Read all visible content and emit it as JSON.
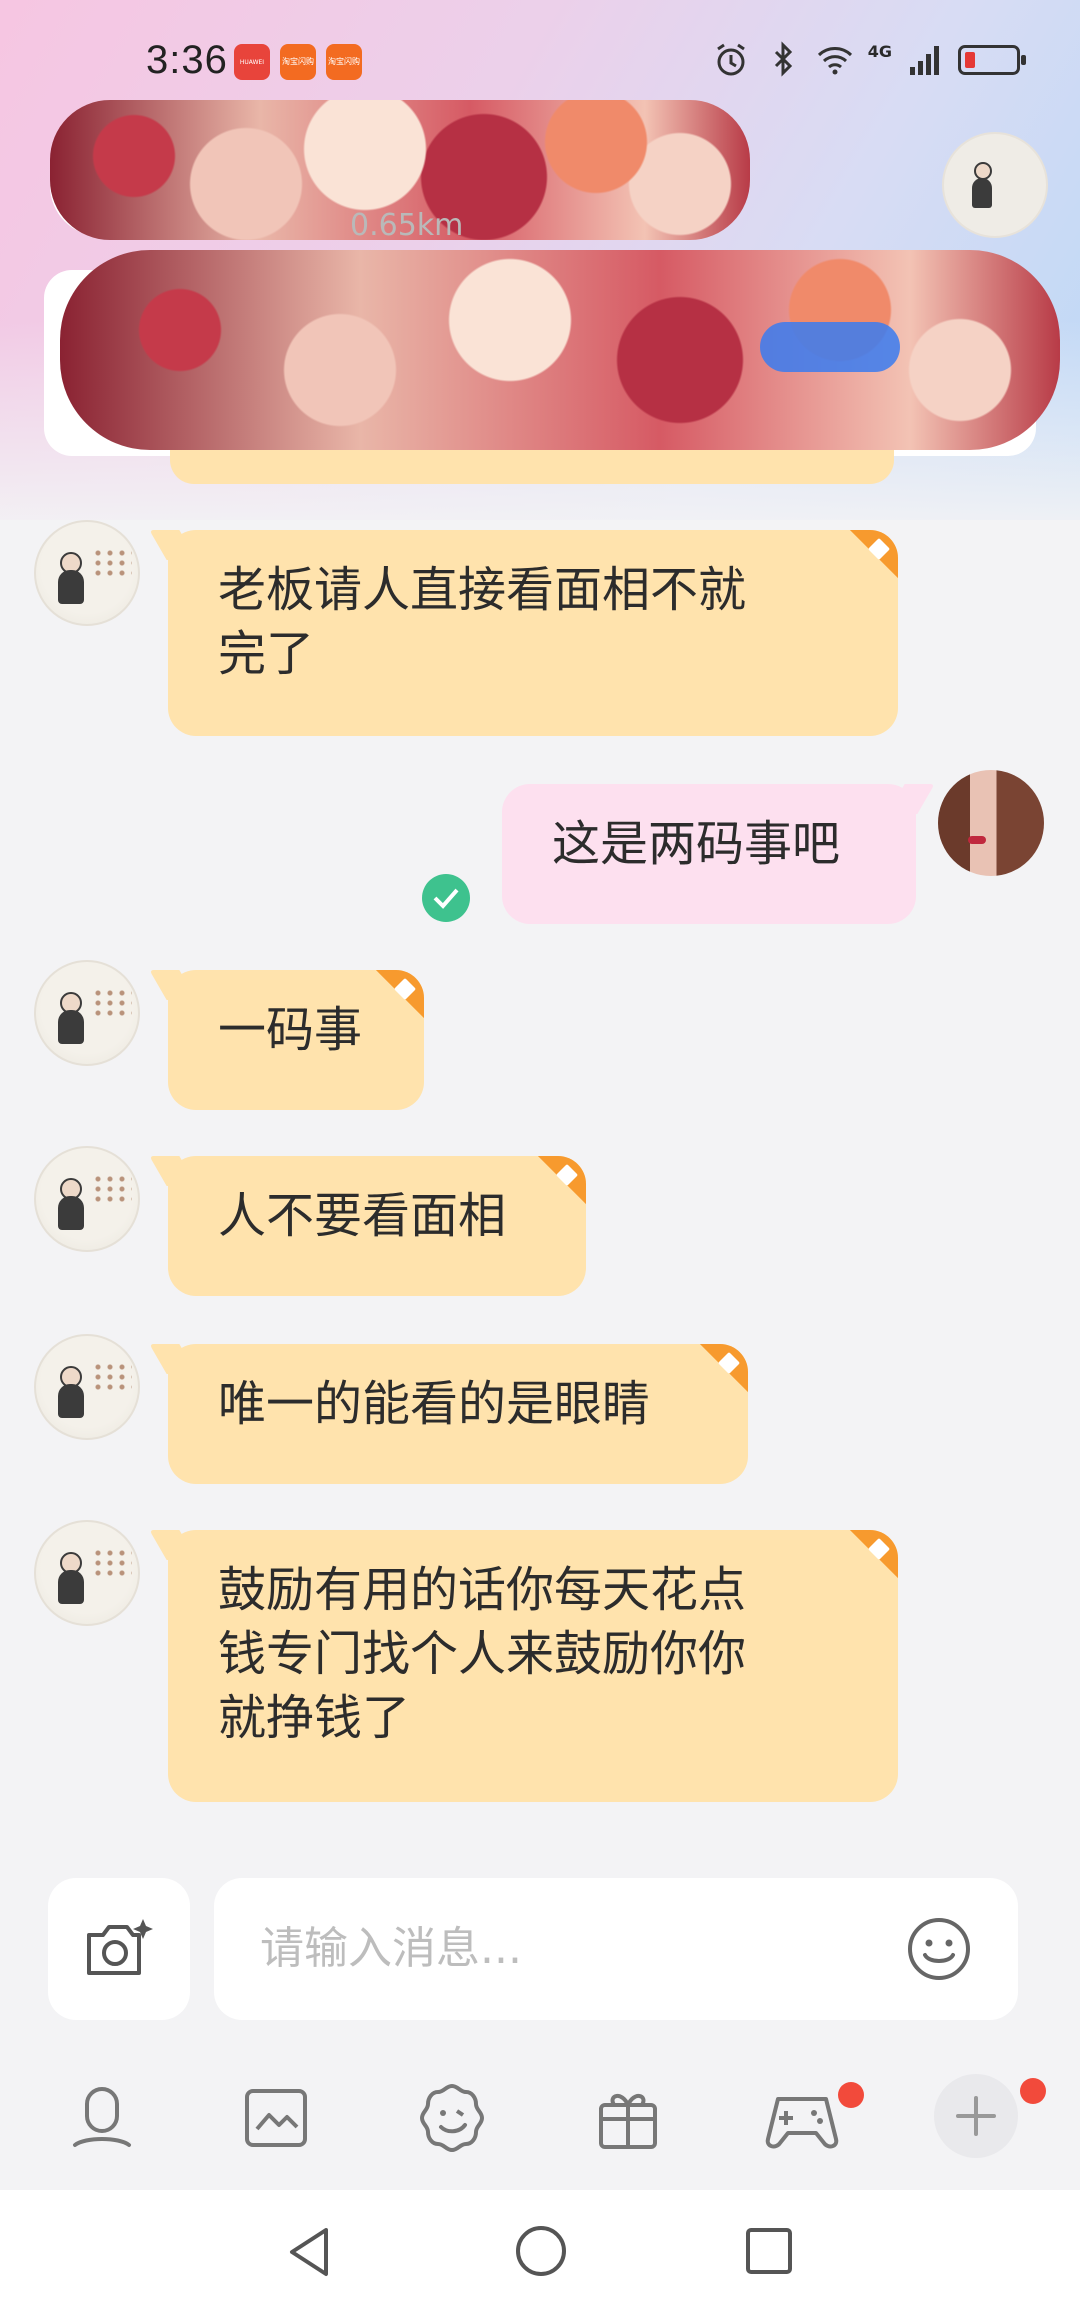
{
  "status_bar": {
    "time": "3:36",
    "apps": [
      {
        "name": "huawei-app-icon",
        "label": "HUAWEI",
        "color": "#e8443b"
      },
      {
        "name": "taobao-flash-icon",
        "label": "淘宝闪购",
        "color": "#f36b21"
      },
      {
        "name": "taobao-flash-icon-2",
        "label": "淘宝闪购",
        "color": "#f36b21"
      }
    ],
    "network": "4G"
  },
  "header": {
    "distance": "0.65km"
  },
  "messages": [
    {
      "side": "left",
      "lines": [
        "老板请人直接看面相不就",
        "完了"
      ]
    },
    {
      "side": "right",
      "lines": [
        "这是两码事吧"
      ],
      "read": true
    },
    {
      "side": "left",
      "lines": [
        "一码事"
      ]
    },
    {
      "side": "left",
      "lines": [
        "人不要看面相"
      ]
    },
    {
      "side": "left",
      "lines": [
        "唯一的能看的是眼睛"
      ]
    },
    {
      "side": "left",
      "lines": [
        "鼓励有用的话你每天花点",
        "钱专门找个人来鼓励你你",
        "就挣钱了"
      ]
    }
  ],
  "input": {
    "placeholder": "请输入消息..."
  },
  "toolbar": {
    "items": [
      "voice-icon",
      "image-icon",
      "sticker-icon",
      "gift-icon",
      "game-icon",
      "plus-icon"
    ]
  },
  "colors": {
    "bubble_left": "#ffe3ad",
    "bubble_right": "#fde0ef",
    "ribbon": "#f79a2e",
    "read_check": "#3ec28e",
    "badge_dot": "#f24a3b"
  }
}
